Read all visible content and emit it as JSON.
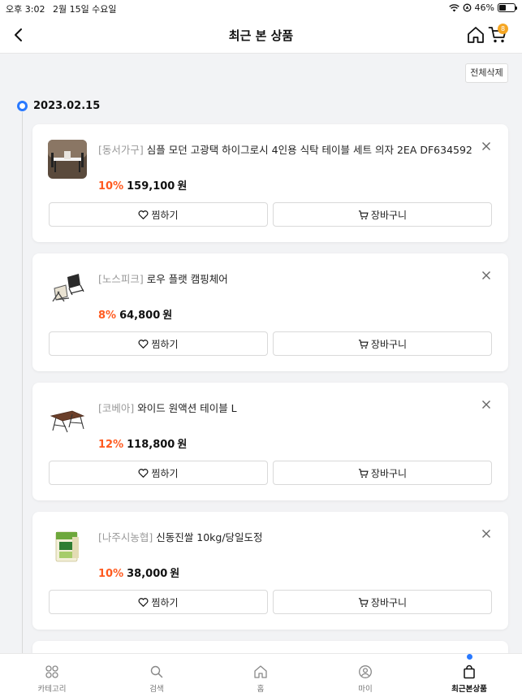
{
  "status_bar": {
    "time": "오후 3:02",
    "date": "2월 15일 수요일",
    "battery": "46%",
    "battery_level": 0.46
  },
  "header": {
    "title": "최근 본 상품",
    "cart_count": "8"
  },
  "delete_all_label": "전체삭제",
  "date_group": "2023.02.15",
  "products": [
    {
      "brand": "[동서가구]",
      "name": "심플 모던 고광택 하이그로시 4인용 식탁 테이블 세트 의자 2EA DF634592",
      "discount": "10%",
      "price": "159,100",
      "unit": "원",
      "wish_label": "찜하기",
      "cart_label": "장바구니",
      "thumb_icon": "dining-table-set-icon"
    },
    {
      "brand": "[노스피크]",
      "name": "로우 플랫 캠핑체어",
      "discount": "8%",
      "price": "64,800",
      "unit": "원",
      "wish_label": "찜하기",
      "cart_label": "장바구니",
      "thumb_icon": "camping-chair-icon"
    },
    {
      "brand": "[코베아]",
      "name": "와이드 원액션 테이블 L",
      "discount": "12%",
      "price": "118,800",
      "unit": "원",
      "wish_label": "찜하기",
      "cart_label": "장바구니",
      "thumb_icon": "folding-table-icon"
    },
    {
      "brand": "[나주시농협]",
      "name": "신동진쌀 10kg/당일도정",
      "discount": "10%",
      "price": "38,000",
      "unit": "원",
      "wish_label": "찜하기",
      "cart_label": "장바구니",
      "thumb_icon": "rice-bag-icon"
    }
  ],
  "bottom_nav": [
    {
      "label": "카테고리",
      "icon": "category-grid-icon"
    },
    {
      "label": "검색",
      "icon": "search-icon"
    },
    {
      "label": "홈",
      "icon": "home-icon"
    },
    {
      "label": "마이",
      "icon": "user-icon"
    },
    {
      "label": "최근본상품",
      "icon": "shopping-bag-icon",
      "active": true
    }
  ],
  "colors": {
    "accent_blue": "#2979ff",
    "discount_orange": "#ff5a1f",
    "badge_orange": "#f5a623"
  }
}
